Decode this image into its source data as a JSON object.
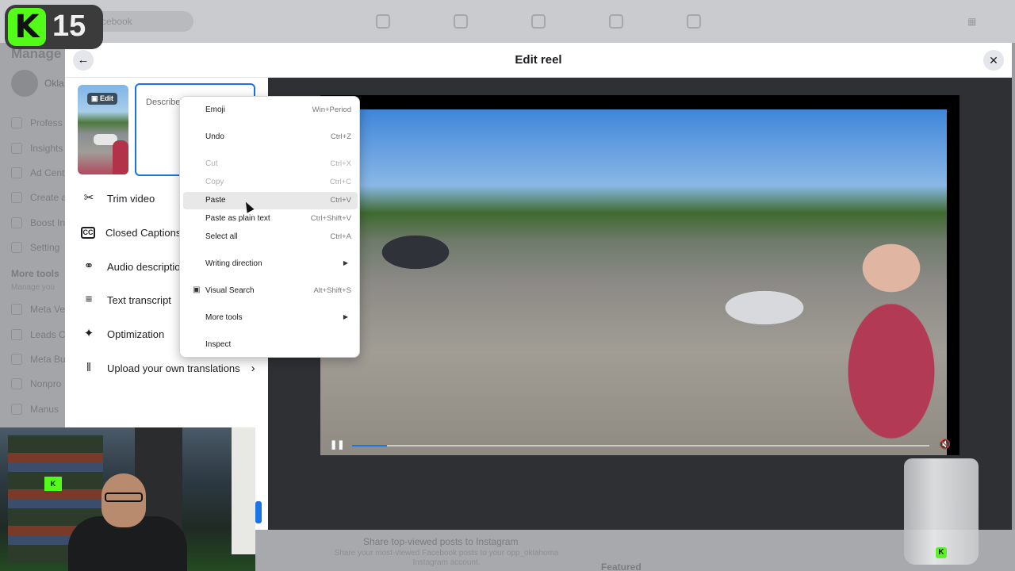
{
  "background": {
    "search_placeholder": "Facebook",
    "sidebar": {
      "title": "Manage",
      "page_name": "Okla",
      "items": [
        "Profess",
        "Insights",
        "Ad Cent",
        "Create a",
        "Boost In",
        "Setting"
      ],
      "more_tools_heading": "More tools",
      "more_tools_sub": "Manage you",
      "more_items": [
        "Meta Ve",
        "Leads C",
        "Meta Bu",
        "Nonpro",
        "Manus"
      ]
    },
    "bottom": {
      "title": "Share top-viewed posts to Instagram",
      "subtitle": "Share your most-viewed Facebook posts to your opp_oklahoma Instagram account.",
      "featured": "Featured"
    }
  },
  "dialog": {
    "title": "Edit reel",
    "back_icon": "arrow-left-icon",
    "close_icon": "close-icon",
    "thumbnail_edit_label": "Edit",
    "description_placeholder": "Describe",
    "tools": [
      {
        "label": "Trim video",
        "icon": "scissors-icon"
      },
      {
        "label": "Closed Captions",
        "icon": "cc-icon"
      },
      {
        "label": "Audio descriptio",
        "icon": "headphones-icon"
      },
      {
        "label": "Text transcript",
        "icon": "lines-icon"
      },
      {
        "label": "Optimization",
        "icon": "wand-icon"
      },
      {
        "label": "Upload your own translations",
        "icon": "translate-icon"
      }
    ],
    "video": {
      "progress": 0.06
    }
  },
  "context_menu": {
    "items": [
      {
        "label": "Emoji",
        "shortcut": "Win+Period"
      },
      {
        "label": "Undo",
        "shortcut": "Ctrl+Z"
      },
      {
        "label": "Cut",
        "shortcut": "Ctrl+X",
        "disabled": true
      },
      {
        "label": "Copy",
        "shortcut": "Ctrl+C",
        "disabled": true
      },
      {
        "label": "Paste",
        "shortcut": "Ctrl+V"
      },
      {
        "label": "Paste as plain text",
        "shortcut": "Ctrl+Shift+V"
      },
      {
        "label": "Select all",
        "shortcut": "Ctrl+A"
      },
      {
        "label": "Writing direction",
        "submenu": true
      },
      {
        "label": "Visual Search",
        "shortcut": "Alt+Shift+S",
        "icon": "visual-search-icon"
      },
      {
        "label": "More tools",
        "submenu": true
      },
      {
        "label": "Inspect",
        "shortcut": ""
      }
    ]
  },
  "overlay": {
    "badge_letter": "K",
    "badge_number": "15"
  },
  "colors": {
    "accent": "#1b74e4",
    "kick_green": "#53fc18"
  }
}
